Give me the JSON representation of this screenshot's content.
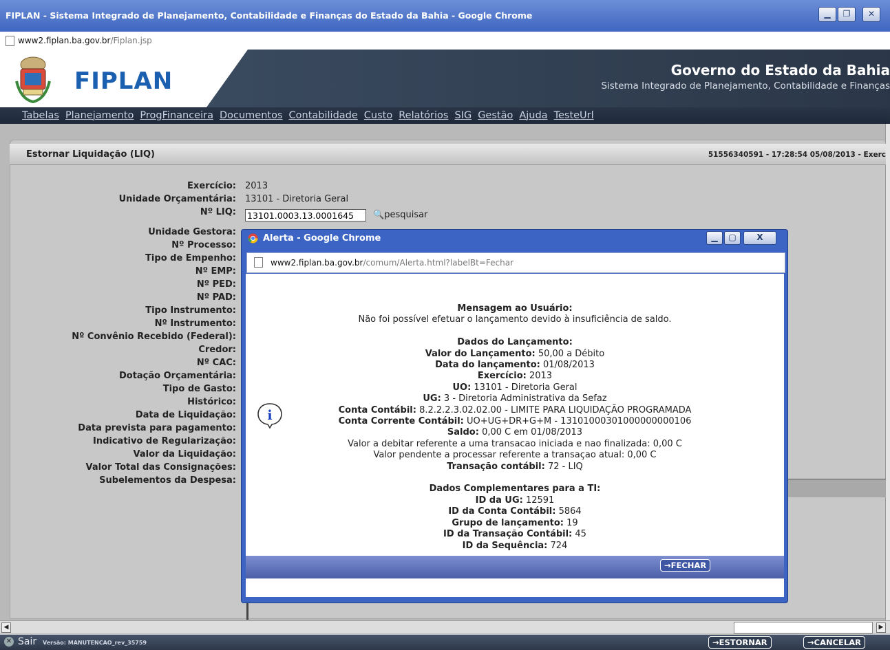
{
  "browser": {
    "window_title": "FIPLAN - Sistema Integrado de Planejamento, Contabilidade e Finanças do Estado da Bahia - Google Chrome",
    "url_host": "www2.fiplan.ba.gov.br",
    "url_path": "/Fiplan.jsp"
  },
  "header": {
    "logo_text": "FIPLAN",
    "gov_title": "Governo do Estado da Bahia",
    "gov_subtitle": "Sistema Integrado de Planejamento, Contabilidade e Finanças"
  },
  "menu": [
    "Tabelas",
    "Planejamento",
    "ProgFinanceira",
    "Documentos",
    "Contabilidade",
    "Custo",
    "Relatórios",
    "SIG",
    "Gestão",
    "Ajuda",
    "TesteUrl"
  ],
  "panel": {
    "title": "Estornar Liquidação (LIQ)",
    "session_info": "51556340591 - 17:28:54 05/08/2013 - Exerc"
  },
  "form": {
    "exercicio_label": "Exercício:",
    "exercicio_value": "2013",
    "unidade_label": "Unidade Orçamentária:",
    "unidade_value": "13101 - Diretoria Geral",
    "liq_label": "Nº LIQ:",
    "liq_value": "13101.0003.13.0001645",
    "search_label": "pesquisar",
    "labels": [
      "Unidade Gestora:",
      "Nº Processo:",
      "Tipo de Empenho:",
      "Nº EMP:",
      "Nº PED:",
      "Nº PAD:",
      "Tipo Instrumento:",
      "Nº Instrumento:",
      "Nº Convênio Recebido (Federal):",
      "Credor:",
      "Nº CAC:",
      "Dotação Orçamentária:",
      "Tipo de Gasto:",
      "Histórico:",
      "Data de Liquidação:",
      "Data prevista para pagamento:",
      "Indicativo de Regularização:",
      "Valor da Liquidação:",
      "Valor Total das Consignações:",
      "Subelementos da Despesa:"
    ]
  },
  "alert": {
    "title": "Alerta - Google Chrome",
    "url_host": "www2.fiplan.ba.gov.br",
    "url_path": "/comum/Alerta.html?labelBt=Fechar",
    "lines": [
      {
        "b": "Mensagem ao Usuário:",
        "t": ""
      },
      {
        "b": "",
        "t": "Não foi possível efetuar o lançamento devido à insuficiência de saldo."
      },
      {
        "b": "",
        "t": ""
      },
      {
        "b": "Dados do Lançamento:",
        "t": ""
      },
      {
        "b": "Valor do Lançamento:",
        "t": " 50,00 a Débito"
      },
      {
        "b": "Data do lançamento:",
        "t": " 01/08/2013"
      },
      {
        "b": "Exercício:",
        "t": " 2013"
      },
      {
        "b": "UO:",
        "t": " 13101 - Diretoria Geral"
      },
      {
        "b": "UG:",
        "t": " 3 - Diretoria Administrativa da Sefaz"
      },
      {
        "b": "Conta Contábil:",
        "t": " 8.2.2.2.3.02.02.00 - LIMITE PARA LIQUIDAÇÃO PROGRAMADA"
      },
      {
        "b": "Conta Corrente Contábil:",
        "t": " UO+UG+DR+G+M - 13101000301000000000106"
      },
      {
        "b": "Saldo:",
        "t": " 0,00 C em 01/08/2013"
      },
      {
        "b": "",
        "t": "Valor a debitar referente a uma transacao iniciada e nao finalizada: 0,00 C"
      },
      {
        "b": "",
        "t": "Valor pendente a processar referente a transaçao atual: 0,00 C"
      },
      {
        "b": "Transação contábil:",
        "t": " 72 - LIQ"
      },
      {
        "b": "",
        "t": ""
      },
      {
        "b": "Dados Complementares para a TI:",
        "t": ""
      },
      {
        "b": "ID da UG:",
        "t": " 12591"
      },
      {
        "b": "ID da Conta Contábil:",
        "t": " 5864"
      },
      {
        "b": "Grupo de lançamento:",
        "t": " 19"
      },
      {
        "b": "ID da Transação Contábil:",
        "t": " 45"
      },
      {
        "b": "ID da Sequência:",
        "t": " 724"
      }
    ],
    "close_button": "FECHAR"
  },
  "statusbar": {
    "exit_label": "Sair",
    "version": "Versão: MANUTENCAO_rev_35759",
    "estornar_button": "ESTORNAR",
    "cancelar_button": "CANCELAR"
  }
}
